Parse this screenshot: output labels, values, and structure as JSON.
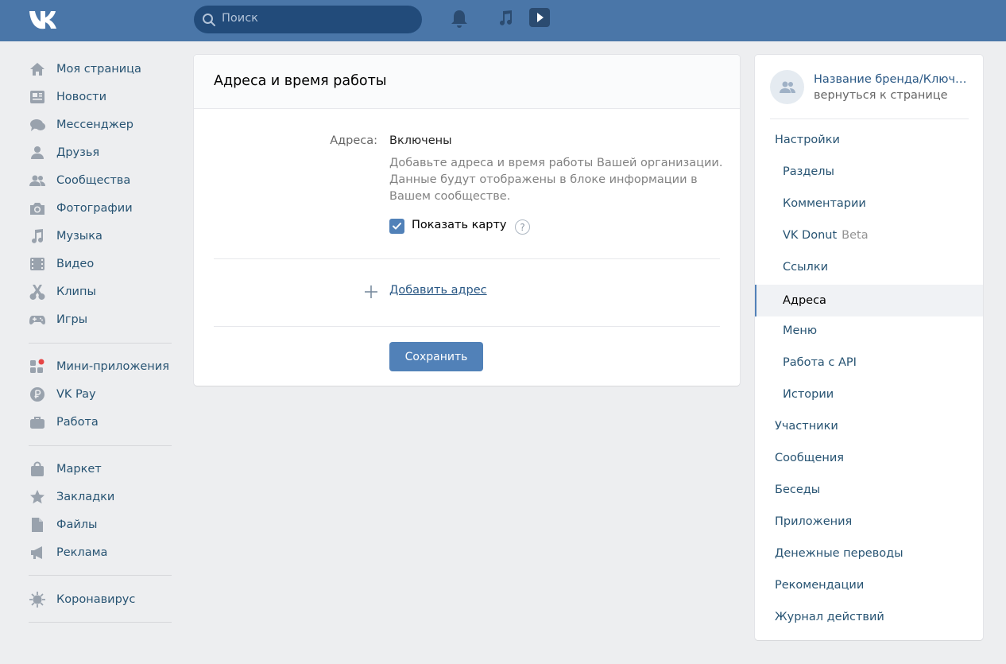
{
  "header": {
    "search_placeholder": "Поиск",
    "icons": [
      "vk-logo-icon",
      "search-icon",
      "bell-icon",
      "music-icon",
      "video-play-icon"
    ]
  },
  "leftnav": {
    "items": [
      {
        "label": "Моя страница",
        "icon": "home-icon"
      },
      {
        "label": "Новости",
        "icon": "news-icon"
      },
      {
        "label": "Мессенджер",
        "icon": "messenger-icon"
      },
      {
        "label": "Друзья",
        "icon": "friends-icon"
      },
      {
        "label": "Сообщества",
        "icon": "communities-icon"
      },
      {
        "label": "Фотографии",
        "icon": "camera-icon"
      },
      {
        "label": "Музыка",
        "icon": "music-icon"
      },
      {
        "label": "Видео",
        "icon": "video-icon"
      },
      {
        "label": "Клипы",
        "icon": "clips-icon"
      },
      {
        "label": "Игры",
        "icon": "gamepad-icon"
      },
      {
        "label": "Мини-приложения",
        "icon": "mini-apps-icon"
      },
      {
        "label": "VK Pay",
        "icon": "vk-pay-icon"
      },
      {
        "label": "Работа",
        "icon": "briefcase-icon"
      },
      {
        "label": "Маркет",
        "icon": "market-bag-icon"
      },
      {
        "label": "Закладки",
        "icon": "star-icon"
      },
      {
        "label": "Файлы",
        "icon": "file-icon"
      },
      {
        "label": "Реклама",
        "icon": "megaphone-icon"
      },
      {
        "label": "Коронавирус",
        "icon": "virus-icon"
      }
    ]
  },
  "main": {
    "title": "Адреса и время работы",
    "addresses_label": "Адреса:",
    "addresses_value": "Включены",
    "description": "Добавьте адреса и время работы Вашей организации. Данные будут отображены в блоке информации в Вашем сообществе.",
    "show_map_label": "Показать карту",
    "show_map_checked": true,
    "help_symbol": "?",
    "add_address_label": "Добавить адрес",
    "save_label": "Сохранить"
  },
  "rightpanel": {
    "group_name": "Название бренда/Ключевое слово",
    "back_label": "вернуться к странице",
    "items": [
      {
        "label": "Настройки",
        "level": "top"
      },
      {
        "label": "Разделы",
        "level": "sub"
      },
      {
        "label": "Комментарии",
        "level": "sub"
      },
      {
        "label": "VK Donut",
        "level": "sub",
        "badge": "Beta"
      },
      {
        "label": "Ссылки",
        "level": "sub"
      },
      {
        "label": "Адреса",
        "level": "sub",
        "active": true
      },
      {
        "label": "Меню",
        "level": "sub"
      },
      {
        "label": "Работа с API",
        "level": "sub"
      },
      {
        "label": "Истории",
        "level": "sub"
      },
      {
        "label": "Участники",
        "level": "top"
      },
      {
        "label": "Сообщения",
        "level": "top"
      },
      {
        "label": "Беседы",
        "level": "top"
      },
      {
        "label": "Приложения",
        "level": "top"
      },
      {
        "label": "Денежные переводы",
        "level": "top"
      },
      {
        "label": "Рекомендации",
        "level": "top"
      },
      {
        "label": "Журнал действий",
        "level": "top"
      }
    ]
  },
  "colors": {
    "header_bg": "#4a76a8",
    "accent": "#5181b8",
    "link": "#2a5885",
    "page_bg": "#edeef0"
  }
}
